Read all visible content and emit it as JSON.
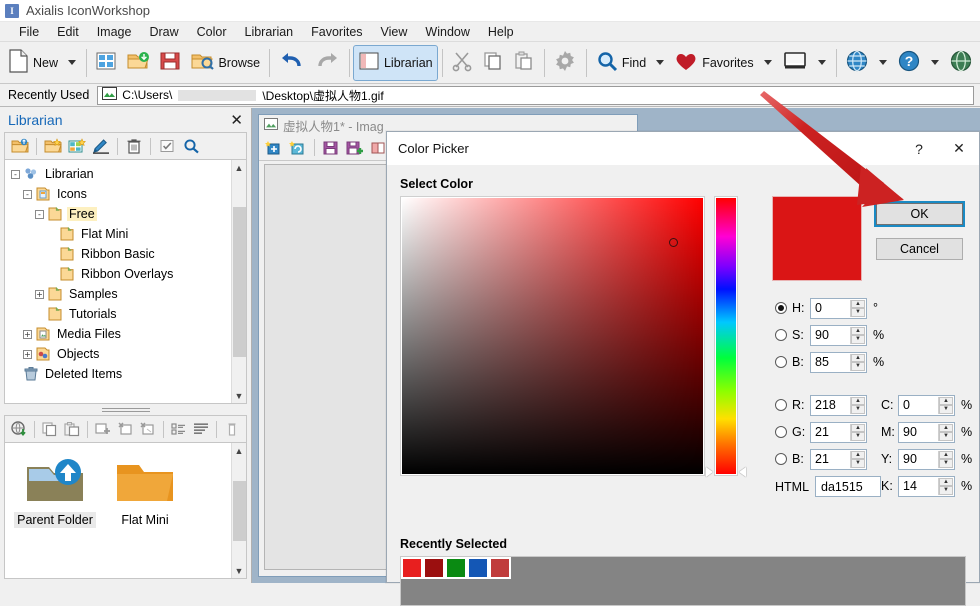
{
  "window": {
    "title": "Axialis IconWorkshop",
    "app_icon": "I"
  },
  "menubar": {
    "items": [
      "File",
      "Edit",
      "Image",
      "Draw",
      "Color",
      "Librarian",
      "Favorites",
      "View",
      "Window",
      "Help"
    ]
  },
  "toolbar": {
    "new_label": "New",
    "browse_label": "Browse",
    "librarian_label": "Librarian",
    "find_label": "Find",
    "favorites_label": "Favorites",
    "icons": [
      "new-document-icon",
      "dropdown-caret",
      "grid-icon",
      "open-folder-icon",
      "save-icon",
      "browse-folder-icon",
      "undo-icon",
      "redo-icon",
      "librarian-icon",
      "cut-icon",
      "copy-icon",
      "paste-icon",
      "settings-gear-icon",
      "search-icon",
      "heart-icon",
      "monitor-icon",
      "globe-icon",
      "help-icon",
      "globe-download-icon"
    ]
  },
  "recent": {
    "label": "Recently Used",
    "path_prefix": "C:\\Users\\",
    "path_suffix": "\\Desktop\\虚拟人物1.gif"
  },
  "librarian_panel": {
    "title": "Librarian",
    "close": "✕",
    "tools": [
      "open-library-icon",
      "new-library-icon",
      "new-icon-set-icon",
      "edit-icon",
      "delete-icon",
      "check-icon",
      "search-icon"
    ],
    "tree": [
      {
        "label": "Librarian",
        "depth": 0,
        "toggle": "-",
        "icon": "librarian-root-icon"
      },
      {
        "label": "Icons",
        "depth": 1,
        "toggle": "-",
        "icon": "icons-folder-icon"
      },
      {
        "label": "Free",
        "depth": 2,
        "toggle": "-",
        "icon": "folder-icon",
        "selected": true
      },
      {
        "label": "Flat Mini",
        "depth": 3,
        "toggle": "",
        "icon": "folder-icon"
      },
      {
        "label": "Ribbon Basic",
        "depth": 3,
        "toggle": "",
        "icon": "folder-icon"
      },
      {
        "label": "Ribbon Overlays",
        "depth": 3,
        "toggle": "",
        "icon": "folder-icon"
      },
      {
        "label": "Samples",
        "depth": 2,
        "toggle": "+",
        "icon": "folder-icon"
      },
      {
        "label": "Tutorials",
        "depth": 2,
        "toggle": "",
        "icon": "folder-icon"
      },
      {
        "label": "Media Files",
        "depth": 1,
        "toggle": "+",
        "icon": "media-folder-icon"
      },
      {
        "label": "Objects",
        "depth": 1,
        "toggle": "+",
        "icon": "objects-folder-icon"
      },
      {
        "label": "Deleted Items",
        "depth": 0,
        "toggle": "",
        "icon": "trash-icon"
      }
    ],
    "grid_tools": [
      "globe-download-icon",
      "copy-icon",
      "paste-icon",
      "add-image-icon",
      "delete-image-icon",
      "export-image-icon",
      "sort-icon",
      "list-icon",
      "trash-icon"
    ],
    "grid_items": [
      {
        "label": "Parent Folder",
        "icon": "parent-folder-icon",
        "selected": true
      },
      {
        "label": "Flat Mini",
        "icon": "folder-icon",
        "selected": false
      }
    ]
  },
  "document": {
    "tab_title": "虚拟人物1* - Imag",
    "tools": [
      "import-icon",
      "refresh-icon",
      "save-icon",
      "save-as-icon",
      "layers-icon"
    ]
  },
  "dialog": {
    "title": "Color Picker",
    "help_glyph": "?",
    "close_glyph": "✕",
    "section_label": "Select Color",
    "ok_label": "OK",
    "cancel_label": "Cancel",
    "preview_color": "#da1515",
    "hsb": [
      {
        "name": "H",
        "value": "0",
        "unit": "°",
        "selected": true,
        "focused": true
      },
      {
        "name": "S",
        "value": "90",
        "unit": "%",
        "selected": false,
        "focused": false
      },
      {
        "name": "B",
        "value": "85",
        "unit": "%",
        "selected": false,
        "focused": false
      }
    ],
    "rgb": [
      {
        "name": "R",
        "value": "218",
        "selected": false
      },
      {
        "name": "G",
        "value": "21",
        "selected": false
      },
      {
        "name": "B",
        "value": "21",
        "selected": false
      }
    ],
    "cmyk": [
      {
        "name": "C",
        "value": "0",
        "unit": "%"
      },
      {
        "name": "M",
        "value": "90",
        "unit": "%"
      },
      {
        "name": "Y",
        "value": "90",
        "unit": "%"
      },
      {
        "name": "K",
        "value": "14",
        "unit": "%"
      }
    ],
    "html": {
      "label": "HTML",
      "value": "da1515"
    },
    "recently_selected": {
      "label": "Recently Selected",
      "swatches": [
        "#e81f1f",
        "#9b0f0f",
        "#0a8a12",
        "#1457b5",
        "#c03b3b"
      ]
    },
    "sv_cursor": {
      "x_pct": 90,
      "y_pct": 16
    },
    "hue_marker_pct": 100
  },
  "annotation": {
    "arrow_color": "#cc2222",
    "points_to": "ok-button"
  }
}
